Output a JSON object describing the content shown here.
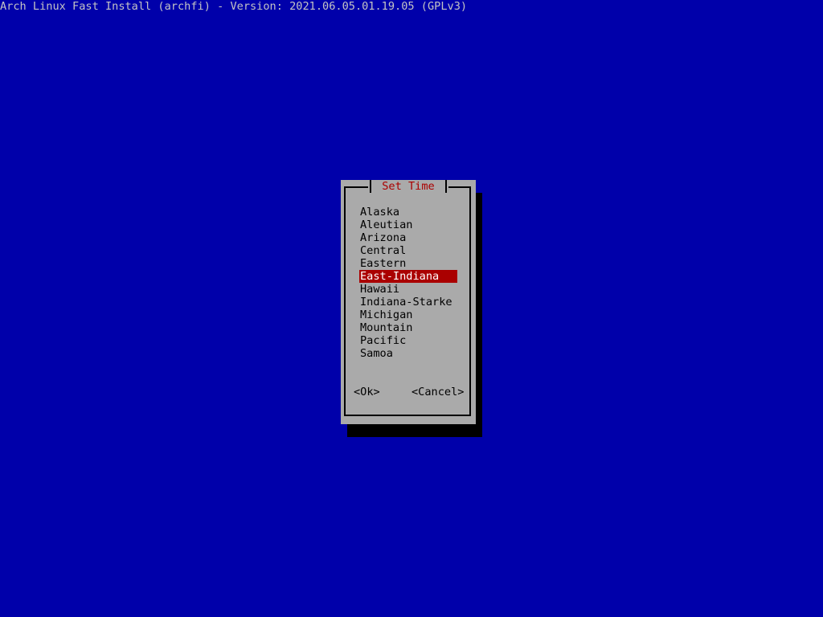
{
  "backtitle": "Arch Linux Fast Install (archfi) - Version: 2021.06.05.01.19.05 (GPLv3)",
  "dialog": {
    "title": "Set Time",
    "items": [
      {
        "label": "Alaska",
        "selected": false
      },
      {
        "label": "Aleutian",
        "selected": false
      },
      {
        "label": "Arizona",
        "selected": false
      },
      {
        "label": "Central",
        "selected": false
      },
      {
        "label": "Eastern",
        "selected": false
      },
      {
        "label": "East-Indiana",
        "selected": true
      },
      {
        "label": "Hawaii",
        "selected": false
      },
      {
        "label": "Indiana-Starke",
        "selected": false
      },
      {
        "label": "Michigan",
        "selected": false
      },
      {
        "label": "Mountain",
        "selected": false
      },
      {
        "label": "Pacific",
        "selected": false
      },
      {
        "label": "Samoa",
        "selected": false
      }
    ],
    "ok_label": "<Ok>",
    "cancel_label": "<Cancel>"
  },
  "colors": {
    "background": "#0000aa",
    "dialog": "#aaaaaa",
    "title": "#aa0000",
    "highlight": "#aa0000",
    "highlight_text": "#ffffff",
    "shadow": "#000000"
  }
}
